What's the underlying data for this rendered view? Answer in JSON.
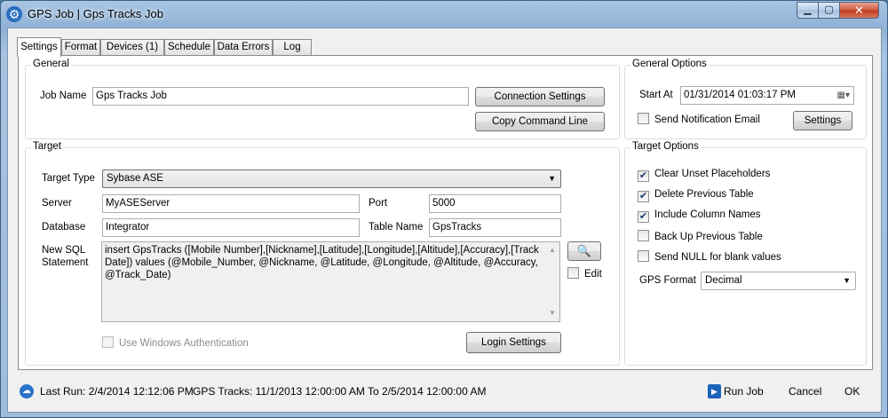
{
  "window": {
    "title": "GPS Job | Gps Tracks Job"
  },
  "window_buttons": {
    "minimize": "▁",
    "maximize": "▢",
    "close": "✕"
  },
  "tabs": [
    {
      "label": "Settings",
      "active": true
    },
    {
      "label": "Format"
    },
    {
      "label": "Devices (1)"
    },
    {
      "label": "Schedule"
    },
    {
      "label": "Data Errors"
    },
    {
      "label": "Log"
    }
  ],
  "general": {
    "title": "General",
    "job_name_label": "Job Name",
    "job_name_value": "Gps Tracks Job",
    "connection_settings_button": "Connection Settings",
    "copy_command_line_button": "Copy Command Line"
  },
  "general_options": {
    "title": "General Options",
    "start_at_label": "Start At",
    "start_at_value": "01/31/2014 01:03:17 PM",
    "send_email_label": "Send Notification Email",
    "settings_button": "Settings"
  },
  "target": {
    "title": "Target",
    "target_type_label": "Target Type",
    "target_type_value": "Sybase ASE",
    "server_label": "Server",
    "server_value": "MyASEServer",
    "port_label": "Port",
    "port_value": "5000",
    "database_label": "Database",
    "database_value": "Integrator",
    "table_name_label": "Table Name",
    "table_name_value": "GpsTracks",
    "sql_label_1": "New SQL",
    "sql_label_2": "Statement",
    "sql_value": "insert GpsTracks ([Mobile Number],[Nickname],[Latitude],[Longitude],[Altitude],[Accuracy],[Track Date]) values (@Mobile_Number, @Nickname, @Latitude, @Longitude, @Altitude, @Accuracy, @Track_Date)",
    "edit_label": "Edit",
    "windows_auth_label": "Use Windows Authentication",
    "login_settings_button": "Login Settings"
  },
  "target_options": {
    "title": "Target Options",
    "clear_unset_label": "Clear Unset Placeholders",
    "delete_previous_label": "Delete Previous Table",
    "include_columns_label": "Include Column Names",
    "backup_previous_label": "Back Up Previous Table",
    "send_null_label": "Send NULL for blank values",
    "gps_format_label": "GPS Format",
    "gps_format_value": "Decimal"
  },
  "status": {
    "last_run": "Last Run: 2/4/2014 12:12:06 PM",
    "gps_tracks": "GPS Tracks: 11/1/2013 12:00:00 AM To 2/5/2014 12:00:00 AM",
    "run_job_button": "Run Job",
    "cancel_button": "Cancel",
    "ok_button": "OK"
  },
  "colors": {
    "title_bar": "#9ebcdc",
    "client_bg": "#f0f0f0",
    "close_button": "#c0391b"
  }
}
